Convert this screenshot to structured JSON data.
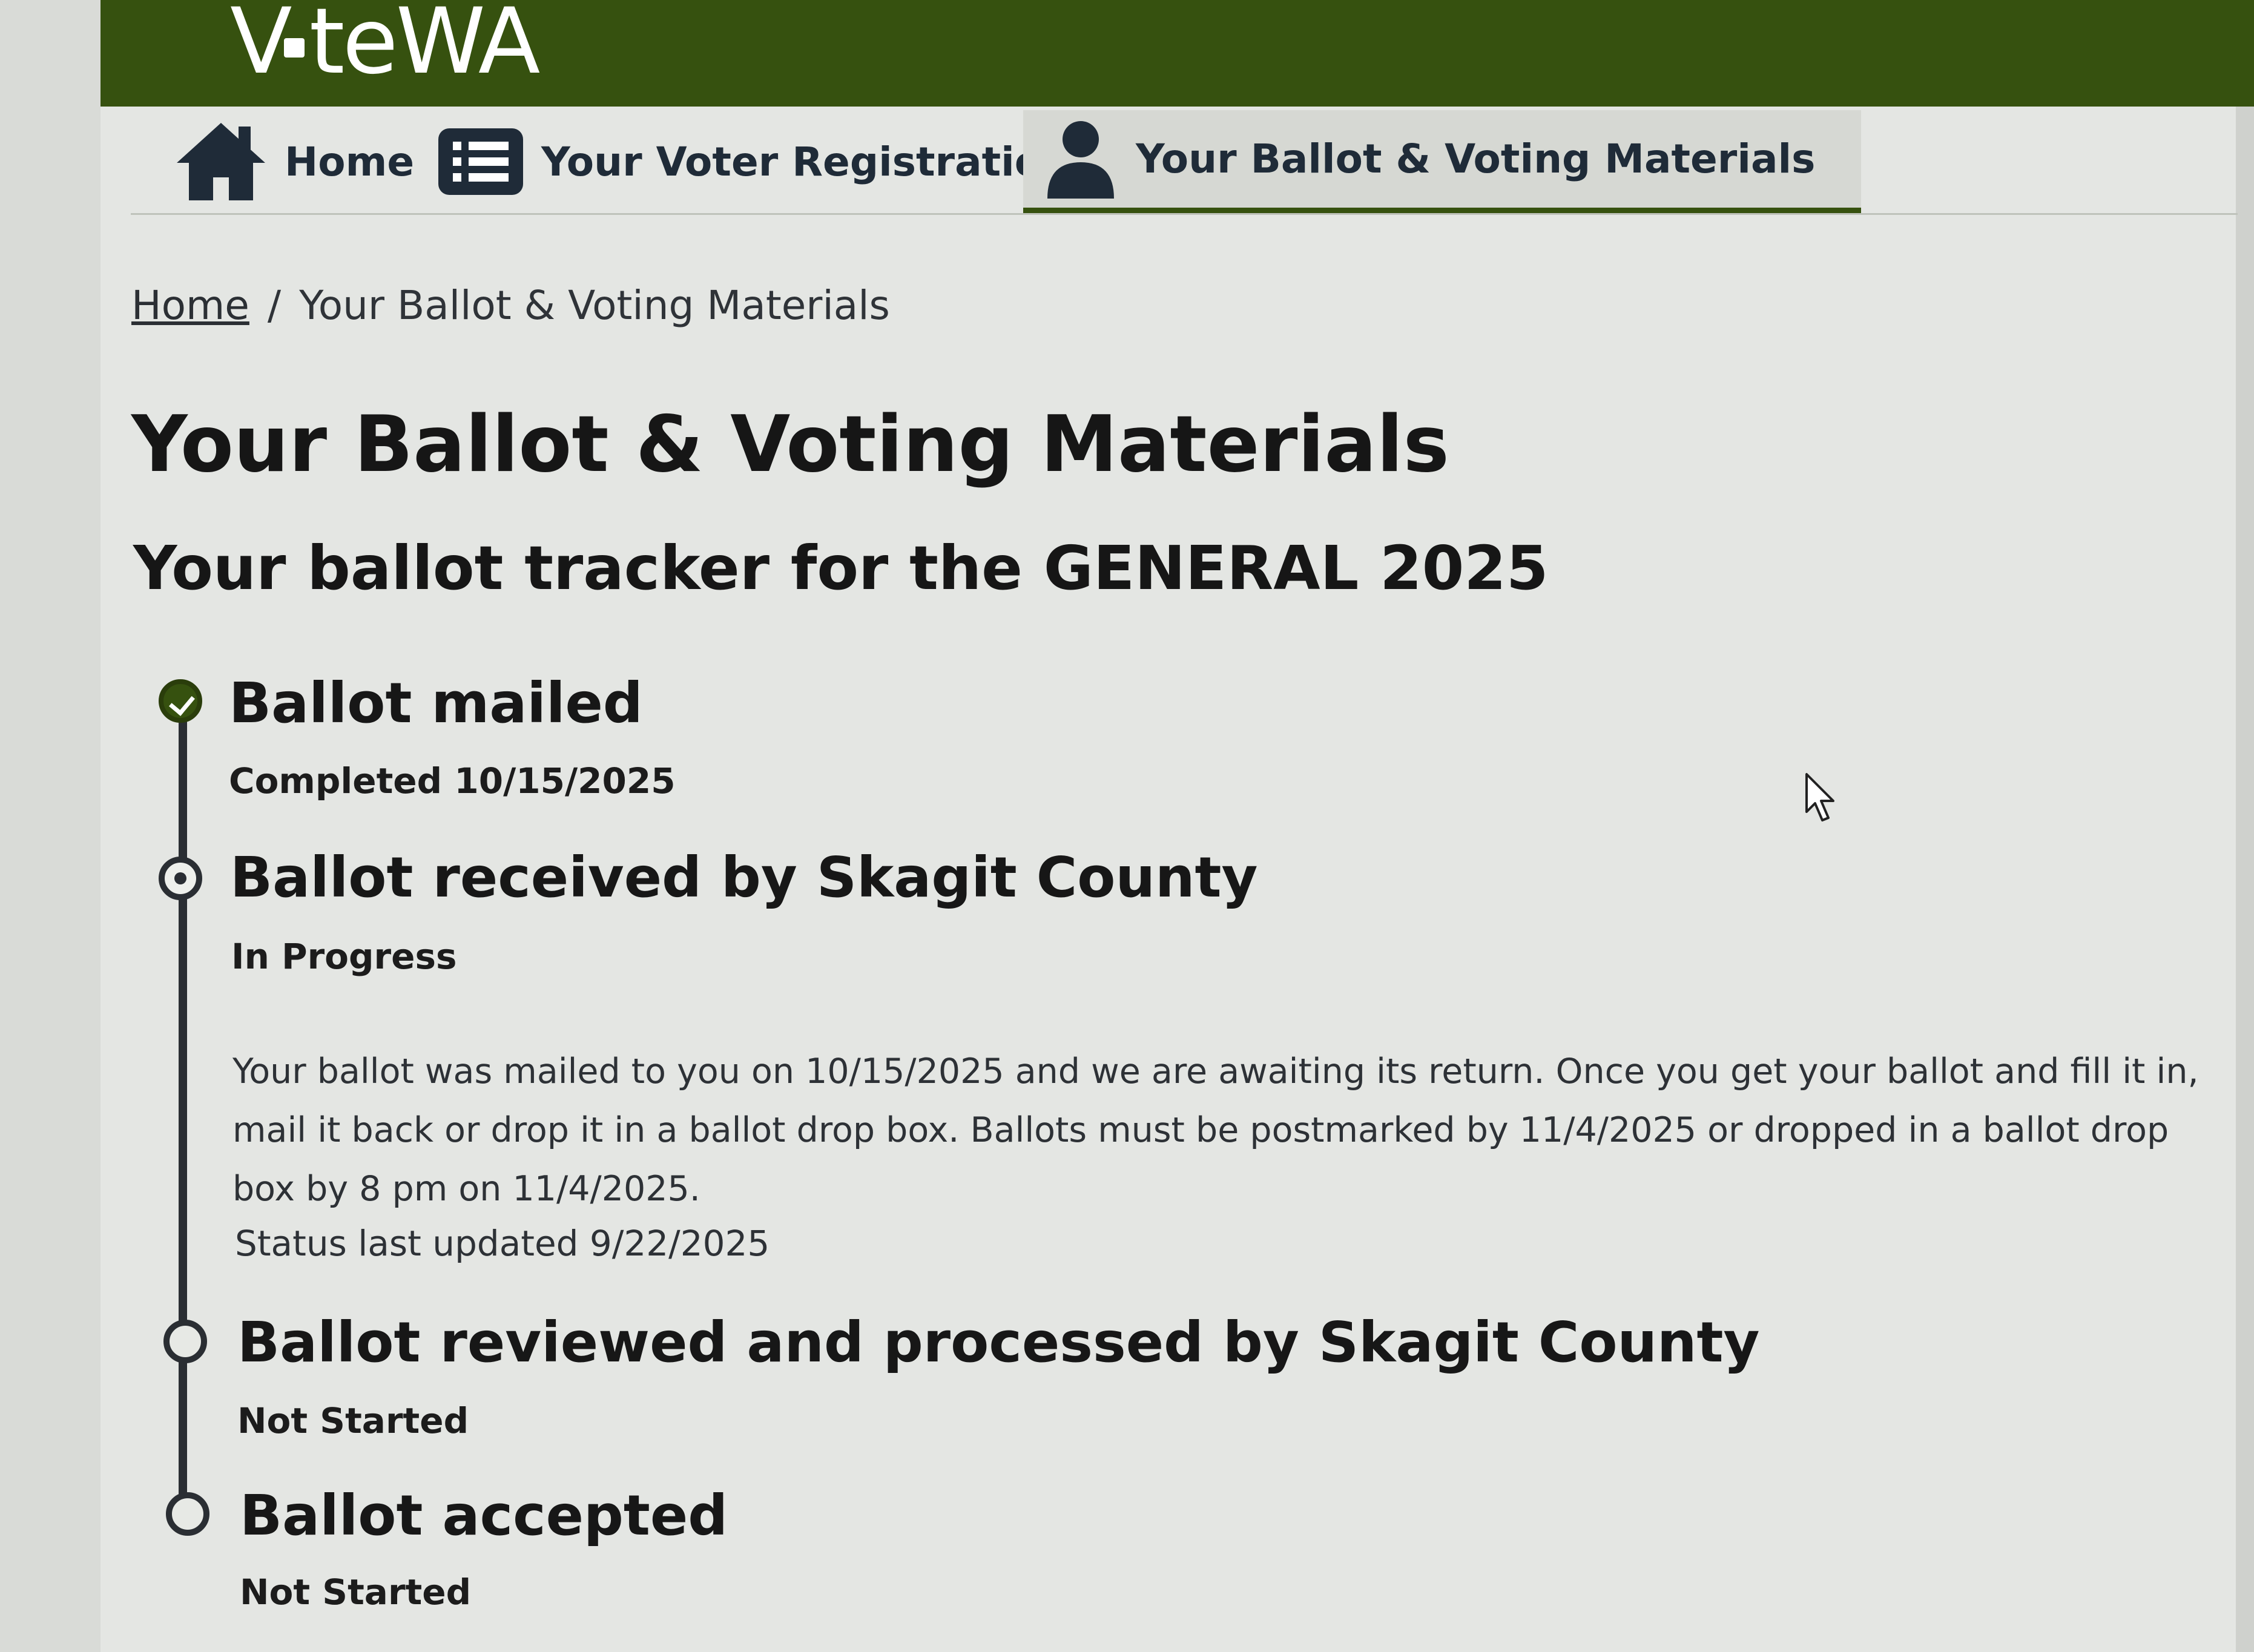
{
  "brand": {
    "logo_text": "VoteWA",
    "logo_prefix": "V",
    "logo_suffix": "teWA",
    "bar_color": "#36510f"
  },
  "nav": {
    "items": [
      {
        "label": "Home",
        "icon": "home-icon",
        "active": false
      },
      {
        "label": "Your Voter Registration",
        "icon": "list-icon",
        "active": false
      },
      {
        "label": "Your Ballot & Voting Materials",
        "icon": "person-icon",
        "active": true
      }
    ]
  },
  "breadcrumb": {
    "home": "Home",
    "separator": "/",
    "current": "Your Ballot & Voting Materials"
  },
  "page": {
    "title": "Your Ballot & Voting Materials",
    "tracker_heading": "Your ballot tracker for the GENERAL 2025"
  },
  "tracker": {
    "steps": [
      {
        "title": "Ballot mailed",
        "status": "Completed 10/15/2025",
        "state": "complete"
      },
      {
        "title": "Ballot received by Skagit County",
        "status": "In Progress",
        "state": "in-progress",
        "description": "Your ballot was mailed to you on 10/15/2025 and we are awaiting its return. Once you get your ballot and fill it in, mail it back or drop it in a ballot drop box. Ballots must be postmarked by 11/4/2025 or dropped in a ballot drop box by 8 pm on 11/4/2025.",
        "last_updated": "Status last updated 9/22/2025"
      },
      {
        "title": "Ballot reviewed and processed by Skagit County",
        "status": "Not Started",
        "state": "not-started"
      },
      {
        "title": "Ballot accepted",
        "status": "Not Started",
        "state": "not-started"
      }
    ]
  },
  "colors": {
    "accent": "#36510f",
    "text": "#1b1b1b",
    "timeline": "#2a2e33"
  }
}
